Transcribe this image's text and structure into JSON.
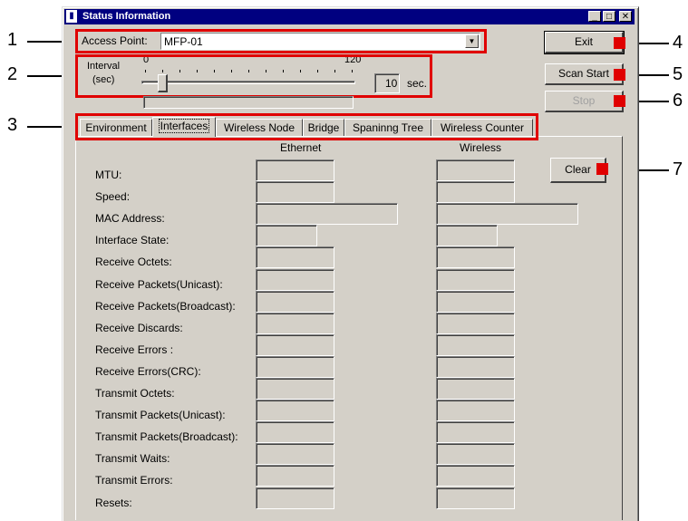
{
  "window": {
    "title": "Status Information"
  },
  "access_point": {
    "label": "Access Point:",
    "value": "MFP-01"
  },
  "interval": {
    "label_line1": "Interval",
    "label_line2": "(sec)",
    "min_label": "0",
    "max_label": "120",
    "slider_value": 10,
    "value_text": "10",
    "unit": "sec."
  },
  "buttons": {
    "exit": "Exit",
    "scan_start": "Scan Start",
    "stop": "Stop",
    "clear": "Clear"
  },
  "tabs": [
    "Environment",
    "Interfaces",
    "Wireless Node",
    "Bridge",
    "Spaninng Tree",
    "Wireless Counter"
  ],
  "active_tab": "Interfaces",
  "columns": {
    "ethernet": "Ethernet",
    "wireless": "Wireless"
  },
  "rows": [
    "MTU:",
    "Speed:",
    "MAC Address:",
    "Interface State:",
    "Receive Octets:",
    "Receive Packets(Unicast):",
    "Receive Packets(Broadcast):",
    "Receive Discards:",
    "Receive Errors :",
    "Receive Errors(CRC):",
    "Transmit Octets:",
    "Transmit Packets(Unicast):",
    "Transmit Packets(Broadcast):",
    "Transmit Waits:",
    "Transmit Errors:",
    "Resets:"
  ],
  "callouts": [
    "1",
    "2",
    "3",
    "4",
    "5",
    "6",
    "7"
  ],
  "colors": {
    "highlight": "#e00000",
    "titlebar": "#000080",
    "face": "#d4d0c8"
  }
}
